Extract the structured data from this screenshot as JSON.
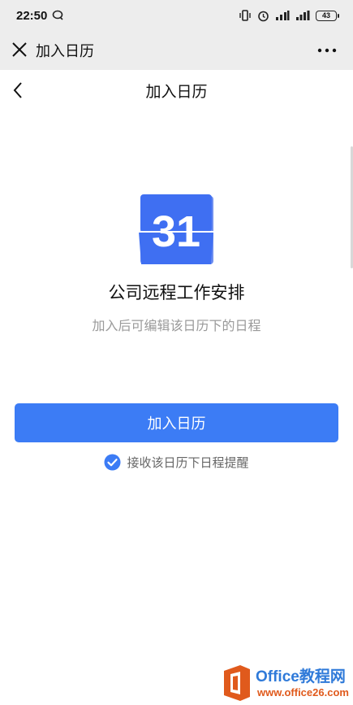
{
  "status_bar": {
    "time": "22:50",
    "battery_level": "43",
    "icons": [
      "chat-bubble-icon",
      "vibrate-icon",
      "alarm-icon",
      "4g-signal-icon",
      "cell-signal-icon",
      "battery-icon"
    ]
  },
  "web_bar": {
    "title": "加入日历",
    "close_icon": "close-icon",
    "more_icon": "more-dots-icon"
  },
  "nav": {
    "title": "加入日历",
    "back_icon": "back-chevron-icon"
  },
  "calendar": {
    "icon_day": "31",
    "title": "公司远程工作安排",
    "subtitle": "加入后可编辑该日历下的日程"
  },
  "actions": {
    "join_label": "加入日历",
    "remind_label": "接收该日历下日程提醒",
    "remind_checked": true
  },
  "watermark": {
    "brand": "Office教程网",
    "url": "www.office26.com"
  },
  "colors": {
    "accent": "#3c7cf5",
    "icon_blue": "#3f6ff2",
    "header_bg": "#ededed",
    "watermark_orange": "#e05a1c",
    "watermark_blue": "#2f7ad9"
  }
}
